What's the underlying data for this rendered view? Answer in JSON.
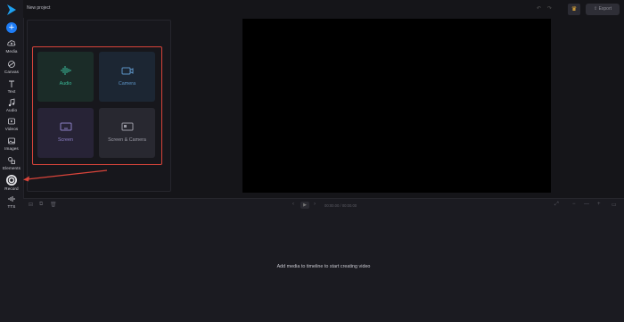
{
  "app": {
    "project_title": "New project",
    "export_label": "Export"
  },
  "rail": {
    "items": [
      {
        "label": "Media"
      },
      {
        "label": "Canvas"
      },
      {
        "label": "Text"
      },
      {
        "label": "Audio"
      },
      {
        "label": "Videos"
      },
      {
        "label": "Images"
      },
      {
        "label": "Elements"
      },
      {
        "label": "Record"
      },
      {
        "label": "TTS"
      }
    ],
    "active": "Record"
  },
  "record": {
    "options": [
      {
        "label": "Audio",
        "icon": "audio-wave-icon"
      },
      {
        "label": "Camera",
        "icon": "camera-icon"
      },
      {
        "label": "Screen",
        "icon": "screen-icon"
      },
      {
        "label": "Screen & Camera",
        "icon": "screen-camera-icon"
      }
    ]
  },
  "timeline": {
    "current_time": "00:00.00",
    "total_time": "00:00.00",
    "empty_message": "Add media to timeline to start creating video"
  },
  "colors": {
    "accent": "#1e7cf5",
    "highlight": "#d8443a",
    "audio": "#3ab897",
    "camera": "#5d94c7",
    "screen": "#8b7fc4"
  }
}
